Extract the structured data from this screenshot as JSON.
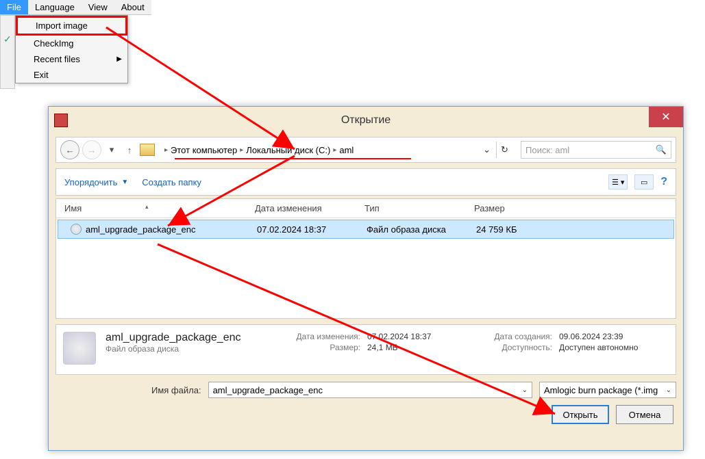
{
  "menubar": {
    "file": "File",
    "language": "Language",
    "view": "View",
    "about": "About"
  },
  "dropdown": {
    "import_image": "Import image",
    "check_img": "CheckImg",
    "recent": "Recent files",
    "exit": "Exit"
  },
  "dialog": {
    "title": "Открытие",
    "breadcrumb": {
      "this_pc": "Этот компьютер",
      "drive": "Локальный диск (C:)",
      "folder": "aml"
    },
    "search_placeholder": "Поиск: aml",
    "toolbar": {
      "organize": "Упорядочить",
      "new_folder": "Создать папку"
    },
    "columns": {
      "name": "Имя",
      "date": "Дата изменения",
      "type": "Тип",
      "size": "Размер"
    },
    "file": {
      "name": "aml_upgrade_package_enc",
      "date": "07.02.2024 18:37",
      "type": "Файл образа диска",
      "size": "24 759 КБ"
    },
    "details": {
      "title": "aml_upgrade_package_enc",
      "type": "Файл образа диска",
      "mod_label": "Дата изменения:",
      "mod_value": "07.02.2024 18:37",
      "size_label": "Размер:",
      "size_value": "24,1 МБ",
      "created_label": "Дата создания:",
      "created_value": "09.06.2024 23:39",
      "avail_label": "Доступность:",
      "avail_value": "Доступен автономно"
    },
    "filename_label": "Имя файла:",
    "filename_value": "aml_upgrade_package_enc",
    "filter": "Amlogic burn package (*.img",
    "open": "Открыть",
    "cancel": "Отмена"
  }
}
